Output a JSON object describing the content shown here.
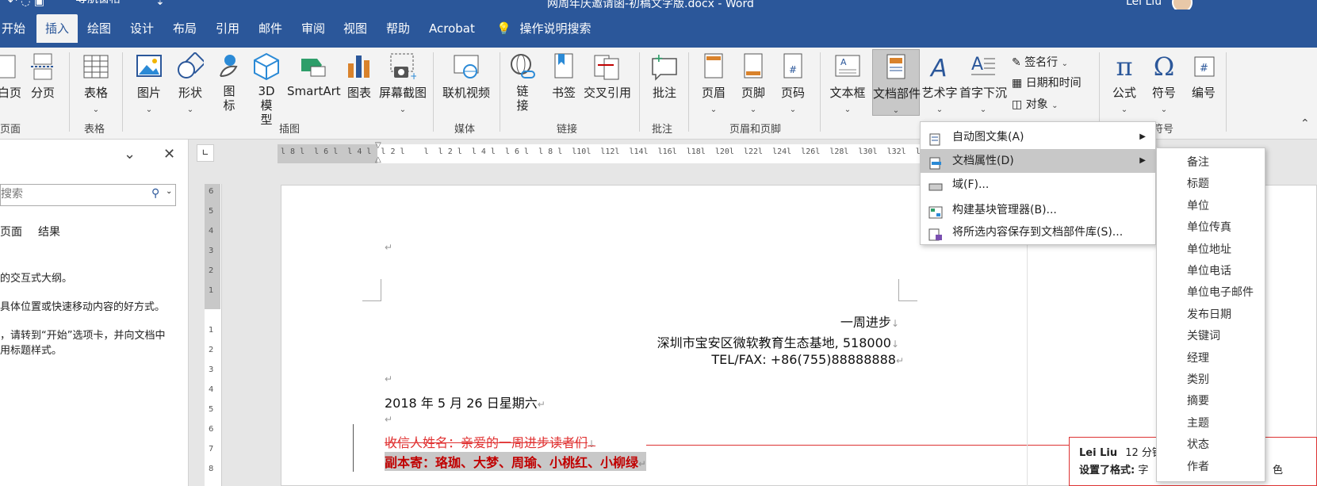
{
  "window": {
    "title": "网周年庆邀请函-初稿文字版.docx  -  Word",
    "user": "Lei Liu",
    "qat_checkbox_label": "导航窗格"
  },
  "tabs": [
    "开始",
    "插入",
    "绘图",
    "设计",
    "布局",
    "引用",
    "邮件",
    "审阅",
    "视图",
    "帮助",
    "Acrobat"
  ],
  "active_tab": "插入",
  "tell_me": "操作说明搜索",
  "ribbon": {
    "pages": {
      "blank_page": "白页",
      "page_break": "分页",
      "group": "页面"
    },
    "tables": {
      "table": "表格",
      "group": "表格"
    },
    "illustrations": {
      "pictures": "图片",
      "shapes": "形状",
      "icons": "图\n标",
      "model3d": "3D 模\n型",
      "smartart": "SmartArt",
      "chart": "图表",
      "screenshot": "屏幕截图",
      "group": "插图"
    },
    "media": {
      "online_video": "联机视频",
      "group": "媒体"
    },
    "links": {
      "link": "链\n接",
      "bookmark": "书签",
      "cross_ref": "交叉引用",
      "group": "链接"
    },
    "comments": {
      "comment": "批注",
      "group": "批注"
    },
    "header_footer": {
      "header": "页眉",
      "footer": "页脚",
      "page_number": "页码",
      "group": "页眉和页脚"
    },
    "text": {
      "textbox": "文本框",
      "quick_parts": "文档部件",
      "wordart": "艺术字",
      "drop_cap": "首字下沉",
      "signature_line": "签名行",
      "date_time": "日期和时间",
      "object": "对象"
    },
    "symbols": {
      "equation": "公式",
      "symbol": "符号",
      "number": "编号",
      "group": "符号"
    }
  },
  "nav_pane": {
    "search_placeholder": "搜索",
    "tabs": [
      "页面",
      "结果"
    ],
    "line1": "的交互式大纲。",
    "line2": "具体位置或快速移动内容的好方式。",
    "line3": "，请转到“开始”选项卡，并向文档中",
    "line4": "用标题样式。"
  },
  "ruler": {
    "h_ticks": "l 8 l  l 6 l  l 4 l  l 2 l    l  l 2 l  l 4 l  l 6 l  l 8 l  l10l  l12l  l14l  l16l  l18l  l20l  l22l  l24l  l26l  l28l  l30l  l32l  l34l  l36l",
    "v_ticks": [
      "6",
      "5",
      "4",
      "3",
      "2",
      "1",
      "",
      "1",
      "2",
      "3",
      "4",
      "5",
      "6",
      "7",
      "8"
    ]
  },
  "quick_parts_menu": [
    {
      "label": "自动图文集(A)",
      "submenu": true
    },
    {
      "label": "文档属性(D)",
      "submenu": true,
      "highlight": true
    },
    {
      "label": "域(F)...",
      "submenu": false
    },
    {
      "label": "构建基块管理器(B)...",
      "submenu": false
    },
    {
      "label": "将所选内容保存到文档部件库(S)...",
      "submenu": false
    }
  ],
  "doc_properties_submenu": [
    "备注",
    "标题",
    "单位",
    "单位传真",
    "单位地址",
    "单位电话",
    "单位电子邮件",
    "发布日期",
    "关键词",
    "经理",
    "类别",
    "摘要",
    "主题",
    "状态",
    "作者"
  ],
  "document": {
    "company": "一周进步",
    "address": "深圳市宝安区微软教育生态基地, 518000",
    "tel": "TEL/FAX: +86(755)88888888",
    "date": "2018 年 5 月 26 日星期六",
    "recipient": "收信人姓名：亲爱的一周进步读者们",
    "cc": "副本寄：珞珈、大梦、周瑜、小桃红、小柳绿",
    "para_mark": "↵",
    "line_mark": "↓"
  },
  "comment": {
    "author": "Lei Liu",
    "time": "12 分钟",
    "text_prefix": "设置了格式:",
    "text_mid": "字",
    "text_end": "色"
  },
  "colors": {
    "brand": "#2b579a",
    "accent_red": "#c00000",
    "tracked_red": "#e03030"
  }
}
